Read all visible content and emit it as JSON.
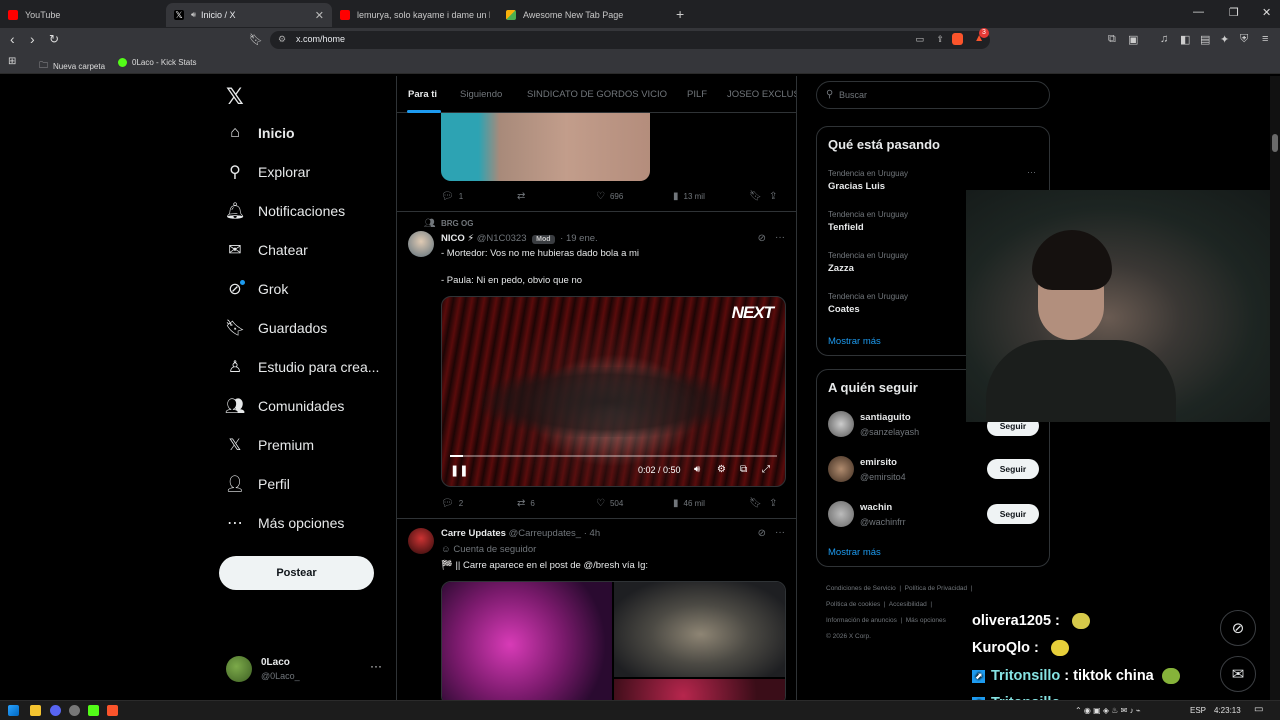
{
  "browser": {
    "tabs": [
      {
        "title": "YouTube",
        "color": "#ff0000"
      },
      {
        "title": "Inicio / X",
        "color": "#e7e9ea"
      },
      {
        "title": "lemurya, solo kayame i dame un beso",
        "color": "#ff0000"
      },
      {
        "title": "Awesome New Tab Page",
        "color": "#f6b10b"
      }
    ],
    "url": "x.com/home",
    "bookmarks": [
      "Nueva carpeta",
      "0Laco - Kick Stats"
    ],
    "notification_count": "3"
  },
  "sidebar": {
    "items": [
      {
        "label": "Inicio",
        "icon": "home-icon"
      },
      {
        "label": "Explorar",
        "icon": "search-icon"
      },
      {
        "label": "Notificaciones",
        "icon": "bell-icon"
      },
      {
        "label": "Chatear",
        "icon": "mail-icon"
      },
      {
        "label": "Grok",
        "icon": "grok-icon"
      },
      {
        "label": "Guardados",
        "icon": "bookmark-icon"
      },
      {
        "label": "Estudio para crea...",
        "icon": "studio-icon"
      },
      {
        "label": "Comunidades",
        "icon": "communities-icon"
      },
      {
        "label": "Premium",
        "icon": "x-icon"
      },
      {
        "label": "Perfil",
        "icon": "person-icon"
      },
      {
        "label": "Más opciones",
        "icon": "more-icon"
      }
    ],
    "post_label": "Postear",
    "profile": {
      "name": "0Laco",
      "handle": "@0Laco_"
    }
  },
  "timeline": {
    "tabs": [
      "Para ti",
      "Siguiendo",
      "SINDICATO DE GORDOS VICIO",
      "PILF",
      "JOSEO EXCLUSI"
    ],
    "tweet0": {
      "replies": "1",
      "likes": "696",
      "views": "13 mil"
    },
    "tweet1": {
      "community": "BRG OG",
      "name": "NICO ⚡",
      "handle": "@N1C0323",
      "badge": "Mod",
      "time": "· 19 ene.",
      "line1": "- Mortedor: Vos no me hubieras dado bola a mi",
      "line2": "- Paula: Ni en pedo, obvio que no",
      "video_brand": "NEXT",
      "video_time": "0:02 / 0:50",
      "video_progress": 0.04,
      "replies": "2",
      "reposts": "6",
      "likes": "504",
      "views": "46 mil"
    },
    "tweet2": {
      "name": "Carre Updates",
      "handle": "@Carreupdates_",
      "time": "· 4h",
      "subtitle": "Cuenta de seguidor",
      "text": "🏁 || Carre aparece en el post de @/bresh vía Ig:"
    }
  },
  "right": {
    "search_placeholder": "Buscar",
    "trending_title": "Qué está pasando",
    "trends": [
      {
        "meta": "Tendencia en Uruguay",
        "name": "Gracias Luis"
      },
      {
        "meta": "Tendencia en Uruguay",
        "name": "Tenfield"
      },
      {
        "meta": "Tendencia en Uruguay",
        "name": "Zazza"
      },
      {
        "meta": "Tendencia en Uruguay",
        "name": "Coates"
      }
    ],
    "show_more": "Mostrar más",
    "follow_title": "A quién seguir",
    "follow": [
      {
        "name": "santiaguito",
        "handle": "@sanzelayash",
        "button": "Seguir"
      },
      {
        "name": "emirsito",
        "handle": "@emirsito4",
        "button": "Seguir"
      },
      {
        "name": "wachin",
        "handle": "@wachinfrr",
        "button": "Seguir"
      }
    ],
    "footer": [
      "Condiciones de Servicio",
      "Política de Privacidad",
      "Política de cookies",
      "Accesibilidad",
      "Información de anuncios",
      "Más opciones",
      "© 2026 X Corp."
    ]
  },
  "chat": [
    {
      "user": "olivera1205",
      "msg": ""
    },
    {
      "user": "KuroQlo",
      "msg": ""
    },
    {
      "user": "Tritonsillo",
      "msg": "tiktok china"
    },
    {
      "user": "Tritonsillo",
      "msg": ""
    }
  ],
  "taskbar": {
    "lang": "ESP",
    "time": "4:23:13"
  }
}
